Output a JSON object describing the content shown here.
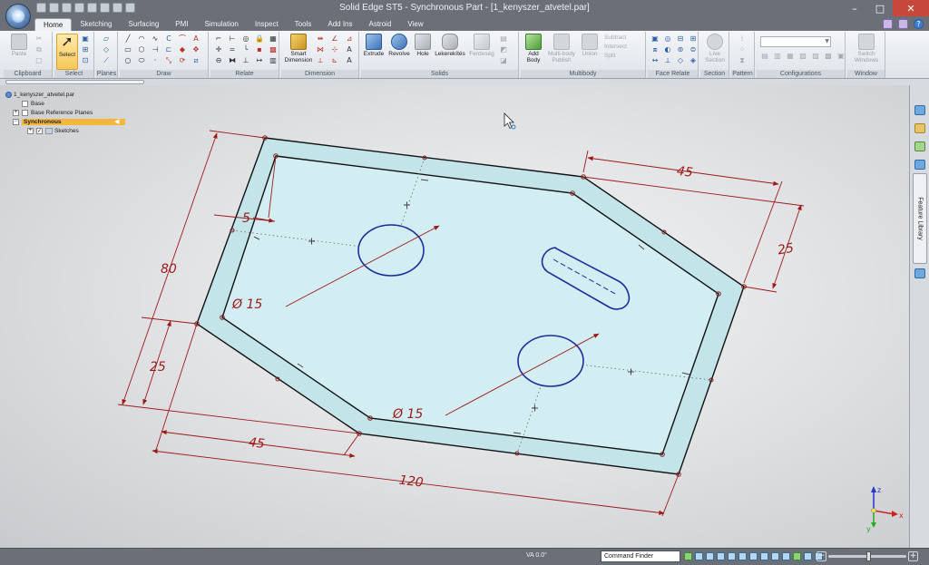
{
  "window": {
    "title": "Solid Edge ST5 - Synchronous Part - [1_kenyszer_atvetel.par]",
    "minimize": "–",
    "maximize": "□",
    "close": "✕"
  },
  "tabs": [
    "Home",
    "Sketching",
    "Surfacing",
    "PMI",
    "Simulation",
    "Inspect",
    "Tools",
    "Add Ins",
    "Astroid",
    "View"
  ],
  "active_tab": "Home",
  "ribbon": {
    "clipboard": {
      "label": "Clipboard",
      "paste": "Paste"
    },
    "select": {
      "label": "Select",
      "select_btn": "Select"
    },
    "planes": {
      "label": "Planes"
    },
    "draw": {
      "label": "Draw"
    },
    "relate": {
      "label": "Relate"
    },
    "dimension": {
      "label": "Dimension",
      "smart_dimension": "Smart Dimension"
    },
    "solids": {
      "label": "Solids",
      "extrude": "Extrude",
      "revolve": "Revolve",
      "hole": "Hole",
      "lekerekites": "Lekerekítés",
      "ferdeseg": "Ferdeség"
    },
    "multibody": {
      "label": "Multibody",
      "add_body": "Add Body",
      "multibody_publish": "Multi-body Publish",
      "union": "Union",
      "subtract": "Subtract",
      "intersect": "Intersect",
      "split": "Split"
    },
    "face_relate": {
      "label": "Face Relate"
    },
    "section": {
      "label": "Section",
      "live_section": "Live Section"
    },
    "pattern": {
      "label": "Pattern"
    },
    "configurations": {
      "label": "Configurations"
    },
    "window_group": {
      "label": "Window",
      "switch_windows": "Switch Windows"
    }
  },
  "pathfinder": {
    "root": "1_kenyszer_atvetel.par",
    "items": [
      "Base",
      "Base Reference Planes",
      "Synchronous",
      "Sketches"
    ]
  },
  "drawing": {
    "dims": {
      "d45_top": "45",
      "d25_right": "25",
      "d5": "5",
      "d80": "80",
      "d25_left": "25",
      "d45_bottom": "45",
      "d120": "120",
      "dia1": "Ø 15",
      "dia2": "Ø 15"
    },
    "colors": {
      "plate_fill": "#c4e6eb",
      "dim_red": "#9c1a1a",
      "hole_blue": "#1c2d9c",
      "edge": "#111111"
    }
  },
  "right_panel": {
    "feature_library": "Feature Library"
  },
  "status": {
    "va": "VA 0.0°",
    "command_finder": "Command Finder"
  },
  "triad": {
    "x": "x",
    "y": "y",
    "z": "z"
  }
}
